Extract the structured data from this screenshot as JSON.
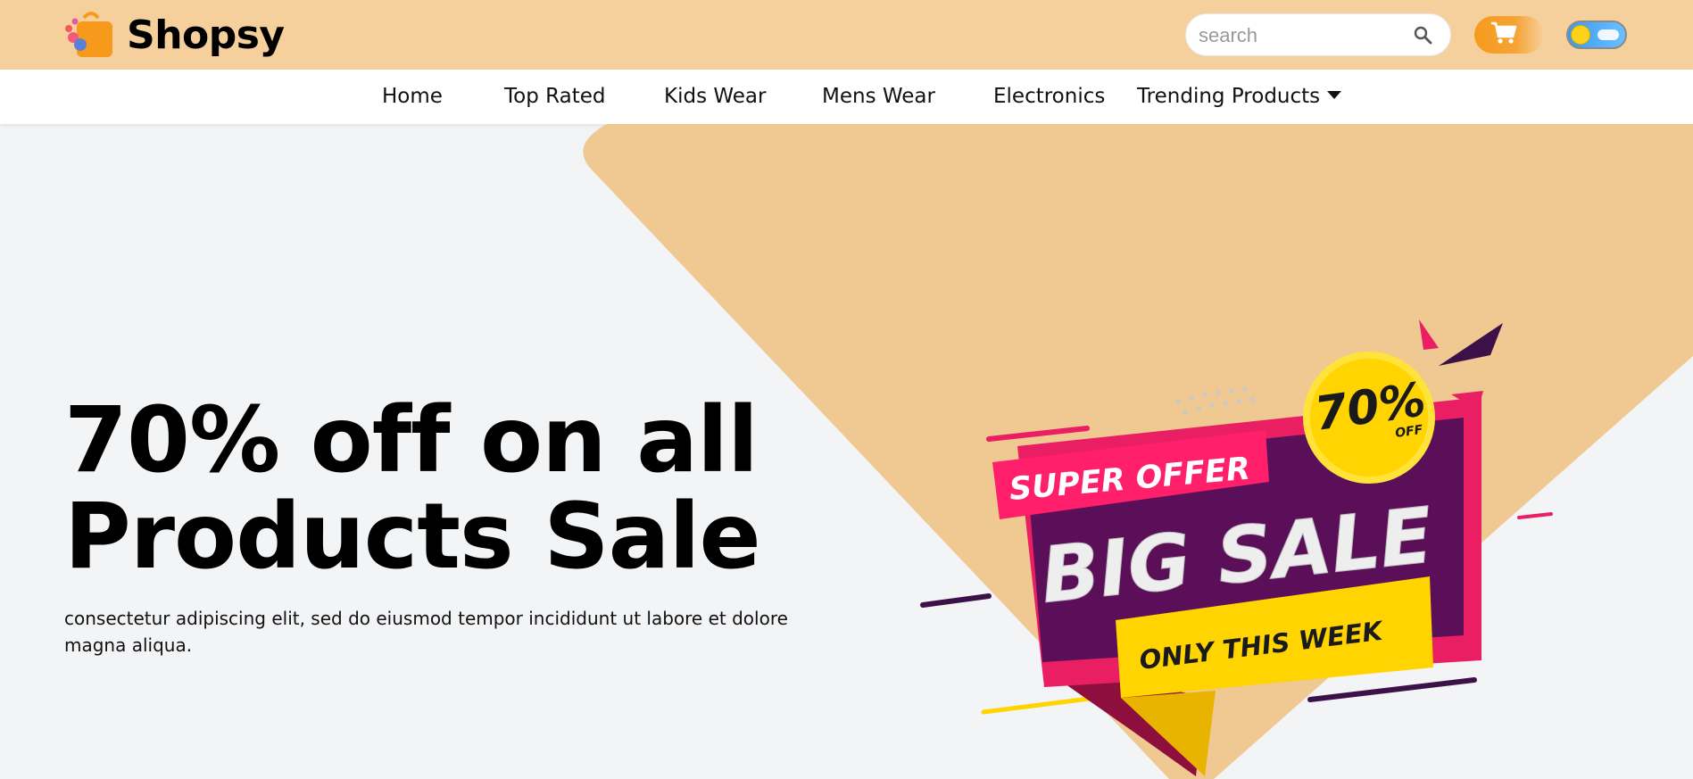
{
  "brand": {
    "name": "Shopsy"
  },
  "search": {
    "placeholder": "search"
  },
  "nav": {
    "items": [
      "Home",
      "Top Rated",
      "Kids Wear",
      "Mens Wear",
      "Electronics"
    ],
    "dropdown_label": "Trending Products"
  },
  "hero": {
    "title_line1": "70% off on all",
    "title_line2": "Products Sale",
    "description": "consectetur adipiscing elit, sed do eiusmod tempor incididunt ut labore et dolore magna aliqua."
  },
  "sale_banner": {
    "tag": "SUPER OFFER",
    "headline": "BIG SALE",
    "subline": "ONLY THIS WEEK",
    "badge_percent": "70%",
    "badge_off": "OFF"
  },
  "colors": {
    "topbar": "#f6d09c",
    "accent": "#f79a1c",
    "hero_shape": "#f0c891",
    "page_bg": "#f3f4f6"
  },
  "icons": {
    "cart": "cart-icon",
    "search": "search-icon",
    "theme": "theme-toggle"
  }
}
